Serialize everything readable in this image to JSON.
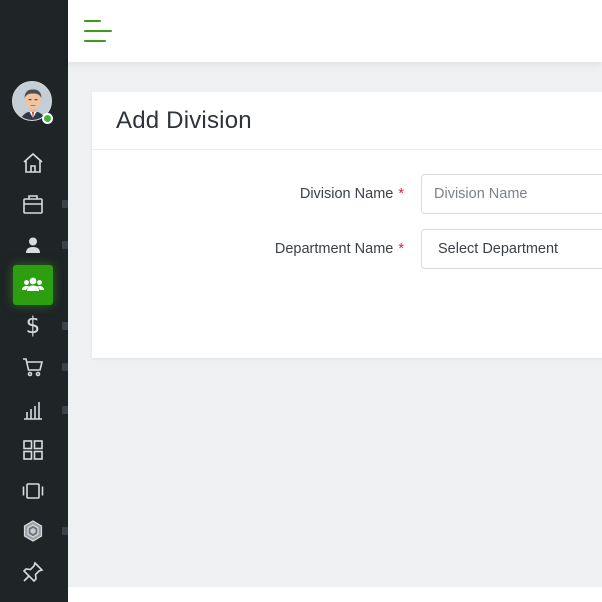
{
  "sidebar": {
    "items": [
      {
        "name": "home",
        "icon": "home-icon"
      },
      {
        "name": "jobs",
        "icon": "briefcase-icon"
      },
      {
        "name": "employee",
        "icon": "user-icon"
      },
      {
        "name": "organization",
        "icon": "users-icon",
        "active": true
      },
      {
        "name": "payroll",
        "icon": "dollar-icon",
        "glyph": "$"
      },
      {
        "name": "purchase",
        "icon": "cart-icon"
      },
      {
        "name": "reports",
        "icon": "bar-chart-icon"
      },
      {
        "name": "dashboard",
        "icon": "grid-icon"
      },
      {
        "name": "assets",
        "icon": "slides-icon"
      },
      {
        "name": "settings",
        "icon": "hexagon-icon"
      },
      {
        "name": "pin",
        "icon": "pin-icon"
      }
    ],
    "active_color": "#2e9e11",
    "background": "#1f2427"
  },
  "topbar": {
    "menu_icon": "hamburger-icon",
    "accent": "#3b9b1b"
  },
  "card": {
    "title": "Add Division"
  },
  "form": {
    "division_name": {
      "label": "Division Name",
      "required_mark": "*",
      "value": "",
      "placeholder": "Division Name"
    },
    "department_name": {
      "label": "Department Name",
      "required_mark": "*",
      "selected": "Select Department"
    }
  }
}
